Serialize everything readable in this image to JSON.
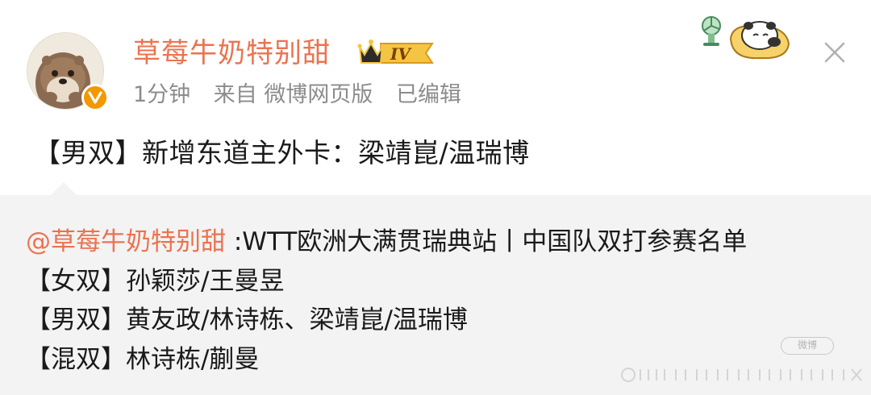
{
  "post": {
    "username": "草莓牛奶特别甜",
    "vip_level": "IV",
    "meta": {
      "time": "1分钟",
      "source": "来自 微博网页版",
      "edited": "已编辑"
    },
    "text": "【男双】新增东道主外卡：梁靖崑/温瑞博"
  },
  "repost": {
    "mention": "@草莓牛奶特别甜",
    "title": " :WTT欧洲大满贯瑞典站丨中国队双打参赛名单",
    "lines": [
      "【女双】孙颖莎/王曼昱",
      "【男双】黄友政/林诗栋、梁靖崑/温瑞博",
      "【混双】林诗栋/蒯曼"
    ]
  },
  "watermark": {
    "text": "微博"
  },
  "colors": {
    "username": "#eb7350",
    "meta": "#8c8c8c",
    "repost_bg": "#f3f3f3",
    "verified": "#f39800"
  },
  "icons": [
    "avatar-otter-icon",
    "verified-icon",
    "vip-crown-icon",
    "sticker-icon",
    "close-icon"
  ]
}
